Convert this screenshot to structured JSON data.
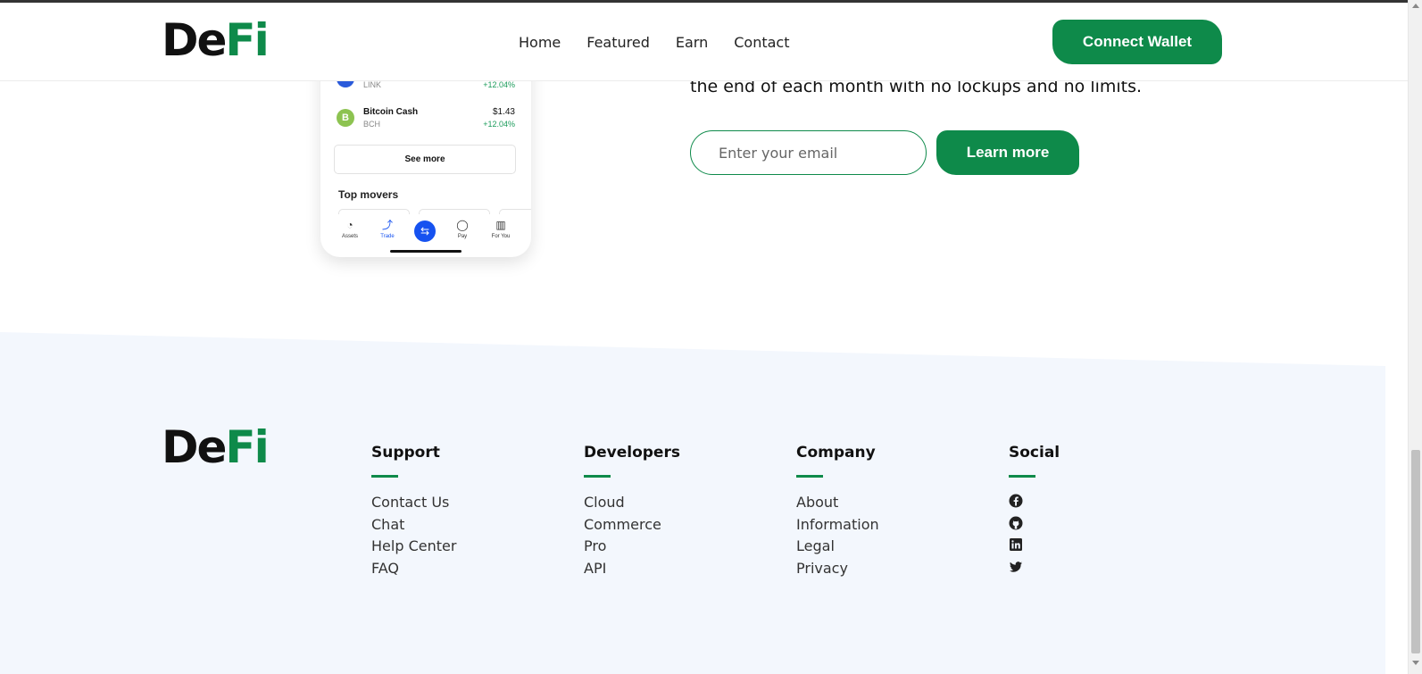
{
  "header": {
    "logo": {
      "part1": "De",
      "part2": "Fi"
    },
    "nav": [
      {
        "label": "Home"
      },
      {
        "label": "Featured"
      },
      {
        "label": "Earn"
      },
      {
        "label": "Contact"
      }
    ],
    "connect_label": "Connect Wallet"
  },
  "phone": {
    "coins": [
      {
        "name": "",
        "symbol": "LINK",
        "price": "",
        "change": "+12.04%",
        "icon_color": "#2a5ada",
        "icon": "chainlink-icon"
      },
      {
        "name": "Bitcoin Cash",
        "symbol": "BCH",
        "price": "$1.43",
        "change": "+12.04%",
        "icon_color": "#8dc351",
        "icon": "bitcoin-cash-icon"
      }
    ],
    "see_more_label": "See more",
    "top_movers_label": "Top movers",
    "tabs": [
      {
        "label": "Assets",
        "icon": "pie-chart-icon",
        "glyph": "◔"
      },
      {
        "label": "Trade",
        "icon": "trend-icon",
        "glyph": "⤴"
      },
      {
        "label": "Pay",
        "icon": "pay-icon",
        "glyph": "◯"
      },
      {
        "label": "For You",
        "icon": "grid-icon",
        "glyph": "▥"
      }
    ],
    "swap_glyph": "⇆"
  },
  "hero": {
    "text": "the end of each month with no lockups and no limits.",
    "email_placeholder": "Enter your email",
    "learn_label": "Learn more"
  },
  "footer": {
    "logo": {
      "part1": "De",
      "part2": "Fi"
    },
    "columns": [
      {
        "title": "Support",
        "links": [
          "Contact Us",
          "Chat",
          "Help Center",
          "FAQ"
        ]
      },
      {
        "title": "Developers",
        "links": [
          "Cloud",
          "Commerce",
          "Pro",
          "API"
        ]
      },
      {
        "title": "Company",
        "links": [
          "About",
          "Information",
          "Legal",
          "Privacy"
        ]
      }
    ],
    "social": {
      "title": "Social",
      "icons": [
        "facebook-icon",
        "github-icon",
        "linkedin-icon",
        "twitter-icon"
      ]
    }
  },
  "colors": {
    "brand_green": "#0e8a4a",
    "footer_bg": "#f3f7fd",
    "accent_blue": "#1652f0"
  }
}
